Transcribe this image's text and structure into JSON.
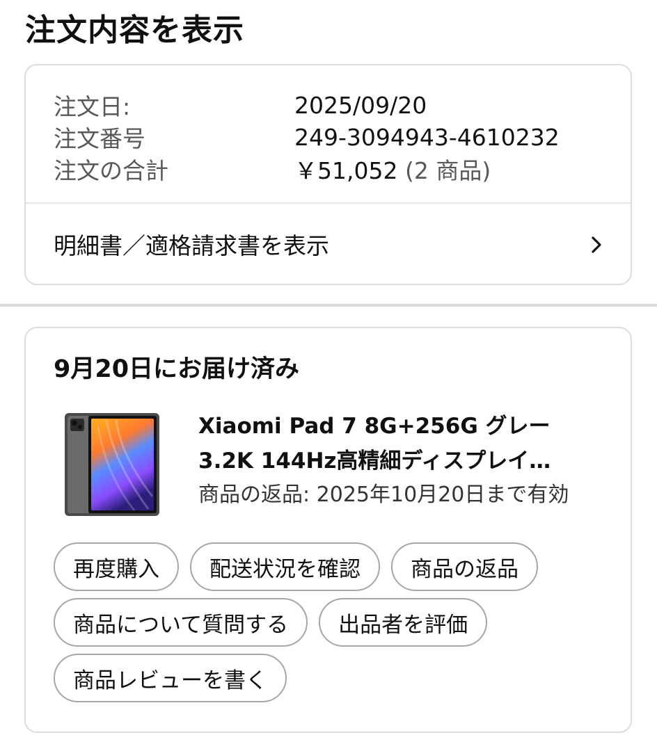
{
  "page": {
    "title": "注文内容を表示"
  },
  "summary": {
    "rows": [
      {
        "label": "注文日:",
        "value": "2025/09/20"
      },
      {
        "label": "注文番号",
        "value": "249-3094943-4610232"
      },
      {
        "label": "注文の合計",
        "value": "￥51,052",
        "suffix": "(2 商品)"
      }
    ],
    "invoice_link": "明細書／適格請求書を表示",
    "chevron_icon": "chevron-right-icon"
  },
  "delivery": {
    "heading": "9月20日にお届け済み",
    "product": {
      "title": "Xiaomi Pad 7 8G+256G グレー 3.2K 144Hz高精細ディスプレイ…",
      "return_info": "商品の返品: 2025年10月20日まで有効",
      "image_icon": "tablet-product-image"
    },
    "buttons": [
      "再度購入",
      "配送状況を確認",
      "商品の返品",
      "商品について質問する",
      "出品者を評価",
      "商品レビューを書く"
    ]
  },
  "colors": {
    "text": "#0f1111",
    "muted": "#565959",
    "border": "#dcdcdc",
    "button_border": "#a6a6a6"
  }
}
